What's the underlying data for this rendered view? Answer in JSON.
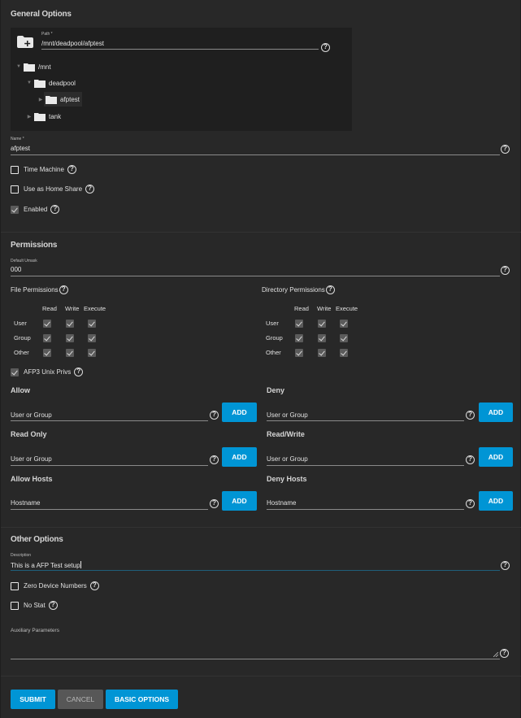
{
  "general": {
    "title": "General Options",
    "path": {
      "label": "Path *",
      "value": "/mnt/deadpool/afptest"
    },
    "tree": [
      {
        "label": "/mnt",
        "expanded": true,
        "level": 0
      },
      {
        "label": "deadpool",
        "expanded": true,
        "level": 1
      },
      {
        "label": "afptest",
        "expanded": false,
        "level": 2,
        "selected": true
      },
      {
        "label": "tank",
        "expanded": false,
        "level": 1
      }
    ],
    "name": {
      "label": "Name *",
      "value": "afptest"
    },
    "checkboxes": [
      {
        "label": "Time Machine",
        "checked": false
      },
      {
        "label": "Use as Home Share",
        "checked": false
      },
      {
        "label": "Enabled",
        "checked": true
      }
    ]
  },
  "permissions": {
    "title": "Permissions",
    "umask": {
      "label": "Default Umask",
      "value": "000"
    },
    "file": {
      "title": "File Permissions",
      "columns": [
        "Read",
        "Write",
        "Execute"
      ],
      "rows": [
        {
          "label": "User",
          "values": [
            true,
            true,
            true
          ]
        },
        {
          "label": "Group",
          "values": [
            true,
            true,
            true
          ]
        },
        {
          "label": "Other",
          "values": [
            true,
            true,
            true
          ]
        }
      ]
    },
    "directory": {
      "title": "Directory Permissions",
      "columns": [
        "Read",
        "Write",
        "Execute"
      ],
      "rows": [
        {
          "label": "User",
          "values": [
            true,
            true,
            true
          ]
        },
        {
          "label": "Group",
          "values": [
            true,
            true,
            true
          ]
        },
        {
          "label": "Other",
          "values": [
            true,
            true,
            true
          ]
        }
      ]
    },
    "afp3": {
      "label": "AFP3 Unix Privs",
      "checked": true
    },
    "lists": [
      {
        "title": "Allow",
        "placeholder": "User or Group",
        "button": "ADD"
      },
      {
        "title": "Deny",
        "placeholder": "User or Group",
        "button": "ADD"
      },
      {
        "title": "Read Only",
        "placeholder": "User or Group",
        "button": "ADD"
      },
      {
        "title": "Read/Write",
        "placeholder": "User or Group",
        "button": "ADD"
      },
      {
        "title": "Allow Hosts",
        "placeholder": "Hostname",
        "button": "ADD"
      },
      {
        "title": "Deny Hosts",
        "placeholder": "Hostname",
        "button": "ADD"
      }
    ]
  },
  "other": {
    "title": "Other Options",
    "description": {
      "label": "Description",
      "value": "This is a AFP Test setup"
    },
    "checkboxes": [
      {
        "label": "Zero Device Numbers",
        "checked": false
      },
      {
        "label": "No Stat",
        "checked": false
      }
    ],
    "aux": {
      "label": "Auxiliary Parameters",
      "value": ""
    }
  },
  "actions": {
    "submit": "SUBMIT",
    "cancel": "CANCEL",
    "basic": "BASIC OPTIONS"
  },
  "help_glyph": "?",
  "colors": {
    "primary": "#0095d5",
    "cancel": "#575757",
    "background": "#282828",
    "panel": "#1f1f1f"
  }
}
